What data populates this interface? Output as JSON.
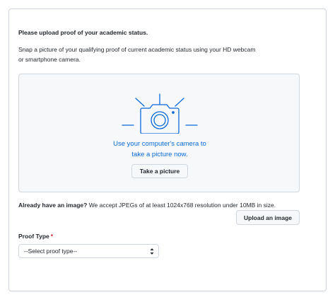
{
  "upload": {
    "heading": "Please upload proof of your academic status.",
    "description": "Snap a picture of your qualifying proof of current academic status using your HD webcam or smartphone camera.",
    "camera_icon": "camera-icon",
    "camera_prompt_line1": "Use your computer's camera to",
    "camera_prompt_line2": "take a picture now.",
    "take_picture_label": "Take a picture",
    "already_bold": "Already have an image?",
    "already_rest": " We accept JPEGs of at least 1024x768 resolution under 10MB in size.",
    "upload_label": "Upload an image"
  },
  "proof": {
    "label": "Proof Type",
    "required_mark": "*",
    "selected": "--Select proof type--"
  },
  "colors": {
    "link_blue": "#0969da",
    "required_red": "#cf222e",
    "dropzone_bg": "#f6f8fa",
    "icon_blue": "#0969da"
  }
}
